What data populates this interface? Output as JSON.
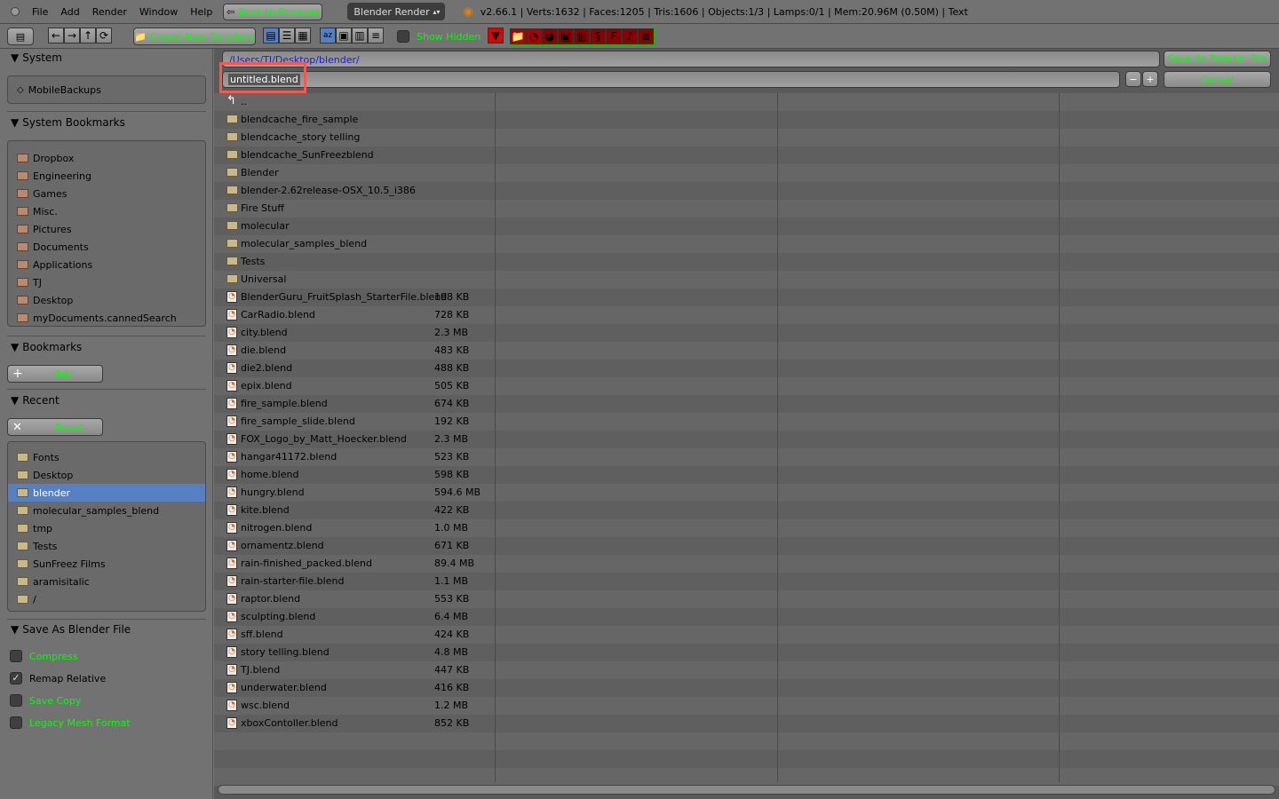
{
  "menubar": {
    "items": [
      "File",
      "Add",
      "Render",
      "Window",
      "Help"
    ],
    "back_label": "Back to Previous",
    "engine": "Blender Render",
    "stats": "v2.66.1 | Verts:1632 | Faces:1205 | Tris:1606 | Objects:1/3 | Lamps:0/1 | Mem:20.96M (0.50M) | Text"
  },
  "toolbar": {
    "create_dir": "Create New Directory",
    "show_hidden": "Show Hidden"
  },
  "path": {
    "directory": "/Users/TJ/Desktop/blender/",
    "filename": "untitled.blend",
    "save": "Save As Blender File",
    "cancel": "Cancel"
  },
  "sidebar": {
    "system": {
      "title": "System",
      "items": [
        "MobileBackups"
      ]
    },
    "system_bookmarks": {
      "title": "System Bookmarks",
      "items": [
        "Dropbox",
        "Engineering",
        "Games",
        "Misc.",
        "Pictures",
        "Documents",
        "Applications",
        "TJ",
        "Desktop",
        "myDocuments.cannedSearch"
      ]
    },
    "bookmarks": {
      "title": "Bookmarks",
      "add": "Add"
    },
    "recent": {
      "title": "Recent",
      "reset": "Reset",
      "items": [
        "Fonts",
        "Desktop",
        "blender",
        "molecular_samples_blend",
        "tmp",
        "Tests",
        "SunFreez Films",
        "aramisitalic",
        "/"
      ],
      "selected": "blender"
    },
    "save_options": {
      "title": "Save As Blender File",
      "options": [
        {
          "label": "Compress",
          "checked": false
        },
        {
          "label": "Remap Relative",
          "checked": true
        },
        {
          "label": "Save Copy",
          "checked": false
        },
        {
          "label": "Legacy Mesh Format",
          "checked": false
        }
      ]
    }
  },
  "files": {
    "parent": "..",
    "folders": [
      "blendcache_fire_sample",
      "blendcache_story telling",
      "blendcache_SunFreezblend",
      "Blender",
      "blender-2.62release-OSX_10.5_i386",
      "Fire Stuff",
      "molecular",
      "molecular_samples_blend",
      "Tests",
      "Universal"
    ],
    "blends": [
      [
        "BlenderGuru_FruitSplash_StarterFile.blend",
        "198 KB"
      ],
      [
        "CarRadio.blend",
        "728 KB"
      ],
      [
        "city.blend",
        "2.3 MB"
      ],
      [
        "die.blend",
        "483 KB"
      ],
      [
        "die2.blend",
        "488 KB"
      ],
      [
        "epix.blend",
        "505 KB"
      ],
      [
        "fire_sample.blend",
        "674 KB"
      ],
      [
        "fire_sample_slide.blend",
        "192 KB"
      ],
      [
        "FOX_Logo_by_Matt_Hoecker.blend",
        "2.3 MB"
      ],
      [
        "hangar41172.blend",
        "523 KB"
      ],
      [
        "home.blend",
        "598 KB"
      ],
      [
        "hungry.blend",
        "594.6 MB"
      ],
      [
        "kite.blend",
        "422 KB"
      ],
      [
        "nitrogen.blend",
        "1.0 MB"
      ],
      [
        "ornamentz.blend",
        "671 KB"
      ],
      [
        "rain-finished_packed.blend",
        "89.4 MB"
      ],
      [
        "rain-starter-file.blend",
        "1.1 MB"
      ],
      [
        "raptor.blend",
        "553 KB"
      ],
      [
        "sculpting.blend",
        "6.4 MB"
      ],
      [
        "sff.blend",
        "424 KB"
      ],
      [
        "story telling.blend",
        "4.8 MB"
      ],
      [
        "TJ.blend",
        "447 KB"
      ],
      [
        "underwater.blend",
        "416 KB"
      ],
      [
        "wsc.blend",
        "1.2 MB"
      ],
      [
        "xboxContoller.blend",
        "852 KB"
      ]
    ]
  },
  "colors": {
    "label_green": "#00ff00",
    "selection": "#5680c2",
    "highlight_box": "#f05a50"
  }
}
